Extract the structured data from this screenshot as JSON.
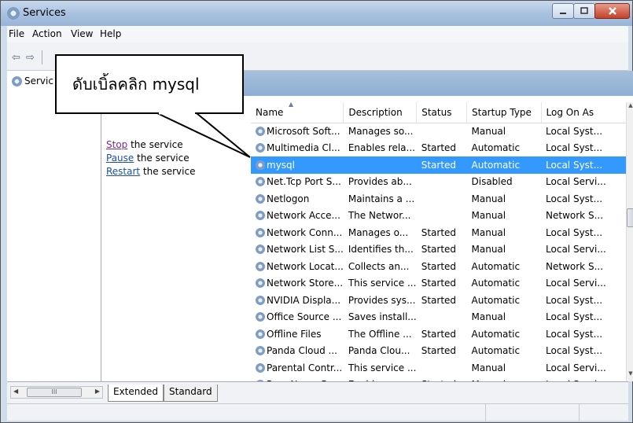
{
  "window": {
    "title": "Services",
    "icon": "services-gear-icon"
  },
  "menu": [
    "File",
    "Action",
    "View",
    "Help"
  ],
  "tree": {
    "item_label": "Servic"
  },
  "actions": {
    "stop_link": "Stop",
    "stop_rest": " the service",
    "pause_link": "Pause",
    "pause_rest": " the service",
    "restart_link": "Restart",
    "restart_rest": " the service"
  },
  "table": {
    "columns": [
      "Name",
      "Description",
      "Status",
      "Startup Type",
      "Log On As"
    ],
    "rows": [
      {
        "name": "Microsoft Soft...",
        "description": "Manages so...",
        "status": "",
        "startup": "Manual",
        "logon": "Local Syst..."
      },
      {
        "name": "Multimedia Cl...",
        "description": "Enables rela...",
        "status": "Started",
        "startup": "Automatic",
        "logon": "Local Syst..."
      },
      {
        "name": "mysql",
        "description": "",
        "status": "Started",
        "startup": "Automatic",
        "logon": "Local Syst...",
        "selected": true
      },
      {
        "name": "Net.Tcp Port S...",
        "description": "Provides ab...",
        "status": "",
        "startup": "Disabled",
        "logon": "Local Servi..."
      },
      {
        "name": "Netlogon",
        "description": "Maintains a ...",
        "status": "",
        "startup": "Manual",
        "logon": "Local Syst..."
      },
      {
        "name": "Network Acce...",
        "description": "The Networ...",
        "status": "",
        "startup": "Manual",
        "logon": "Network S..."
      },
      {
        "name": "Network Conn...",
        "description": "Manages o...",
        "status": "Started",
        "startup": "Manual",
        "logon": "Local Syst..."
      },
      {
        "name": "Network List S...",
        "description": "Identifies th...",
        "status": "Started",
        "startup": "Manual",
        "logon": "Local Servi..."
      },
      {
        "name": "Network Locat...",
        "description": "Collects an...",
        "status": "Started",
        "startup": "Automatic",
        "logon": "Network S..."
      },
      {
        "name": "Network Store...",
        "description": "This service ...",
        "status": "Started",
        "startup": "Automatic",
        "logon": "Local Servi..."
      },
      {
        "name": "NVIDIA Displa...",
        "description": "Provides sys...",
        "status": "Started",
        "startup": "Automatic",
        "logon": "Local Syst..."
      },
      {
        "name": "Office Source ...",
        "description": "Saves install...",
        "status": "",
        "startup": "Manual",
        "logon": "Local Syst..."
      },
      {
        "name": "Offline Files",
        "description": "The Offline ...",
        "status": "Started",
        "startup": "Automatic",
        "logon": "Local Syst..."
      },
      {
        "name": "Panda Cloud ...",
        "description": "Panda Clou...",
        "status": "Started",
        "startup": "Automatic",
        "logon": "Local Syst..."
      },
      {
        "name": "Parental Contr...",
        "description": "This service ...",
        "status": "",
        "startup": "Manual",
        "logon": "Local Servi..."
      },
      {
        "name": "Peer Name Re...",
        "description": "Enables ser...",
        "status": "Started",
        "startup": "Manual",
        "logon": "Local Servi..."
      }
    ]
  },
  "tabs": [
    "Extended",
    "Standard"
  ],
  "callout": {
    "text": "ดับเบิ้ลคลิก mysql"
  },
  "colors": {
    "selection": "#3399ff",
    "header_band": "#8eaed3",
    "titlebar": "#a9c2e0"
  }
}
